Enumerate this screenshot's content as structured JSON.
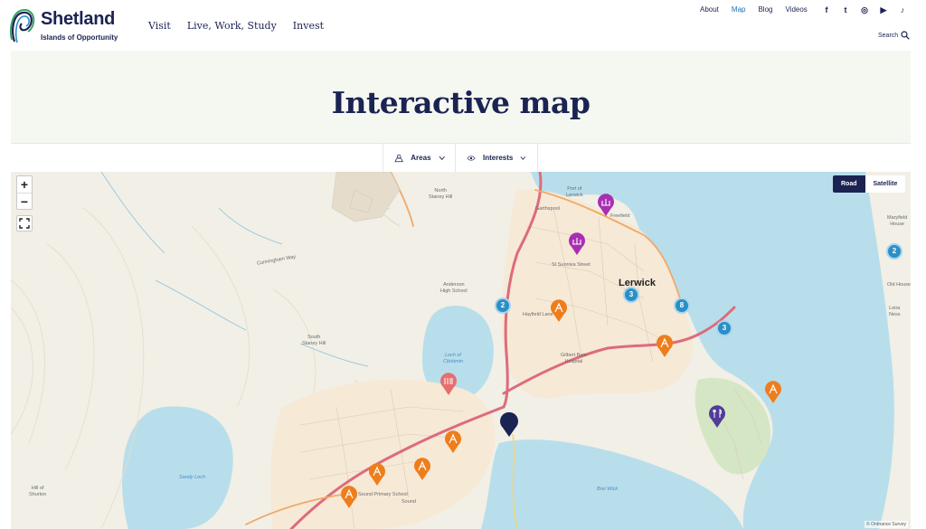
{
  "brand": {
    "name": "Shetland",
    "tagline": "Islands of Opportunity"
  },
  "main_nav": [
    {
      "label": "Visit"
    },
    {
      "label": "Live, Work, Study"
    },
    {
      "label": "Invest"
    }
  ],
  "top_nav": [
    {
      "label": "About"
    },
    {
      "label": "Map",
      "active": true
    },
    {
      "label": "Blog"
    },
    {
      "label": "Videos"
    }
  ],
  "social": [
    {
      "icon": "facebook-icon",
      "glyph": "f"
    },
    {
      "icon": "twitter-icon",
      "glyph": "t"
    },
    {
      "icon": "instagram-icon",
      "glyph": "◎"
    },
    {
      "icon": "youtube-icon",
      "glyph": "▶"
    },
    {
      "icon": "tiktok-icon",
      "glyph": "♪"
    }
  ],
  "search": {
    "label": "Search",
    "icon": "search-icon"
  },
  "hero": {
    "title": "Interactive map"
  },
  "filters": {
    "areas": {
      "label": "Areas",
      "icon": "map-pin-icon"
    },
    "interests": {
      "label": "Interests",
      "icon": "eye-icon"
    }
  },
  "map": {
    "controls": {
      "zoom_in": "+",
      "zoom_out": "−"
    },
    "map_types": {
      "road": "Road",
      "satellite": "Satellite"
    },
    "copyright": "© Ordnance Survey",
    "labels": {
      "lerwick": "Lerwick",
      "north_staney_hill": "North\nStaney Hill",
      "south_staney_hill": "South\nStaney Hill",
      "loch_of_clickimin": "Loch of\nClickimin",
      "sandy_loch": "Sandy Loch",
      "hill_of_shurton": "Hill of\nShurton",
      "anderson_high_school": "Anderson\nHigh School",
      "gilbert_bain_hospital": "Gilbert Bain\nHospital",
      "garthspool": "Garthspool",
      "freefield": "Freefield",
      "port_of_lerwick": "Port of\nLerwick",
      "sound": "Sound",
      "sound_primary_school": "Sound Primary School",
      "cunningham_way": "Cunningham Way",
      "brei_wick": "Brei Wick",
      "bressay_north": "Maryfield\nHouse",
      "old_house": "Old House",
      "leira_ness": "Leira\nNess",
      "st_sunniva_street": "St Sunniva Street",
      "hayfield_lane": "Hayfield Lane"
    },
    "clusters": [
      {
        "label": "2"
      },
      {
        "label": "3"
      },
      {
        "label": "8"
      },
      {
        "label": "3"
      },
      {
        "label": "2"
      }
    ],
    "colors": {
      "activity": "#ee7d1c",
      "heritage": "#a92fb2",
      "food": "#e76e6e",
      "dining": "#4f3d99",
      "cluster": "#2b8fc6",
      "location": "#1b2352",
      "sea": "#b8deeb",
      "land": "#f1efe6",
      "road": "#dd6b7c"
    }
  }
}
